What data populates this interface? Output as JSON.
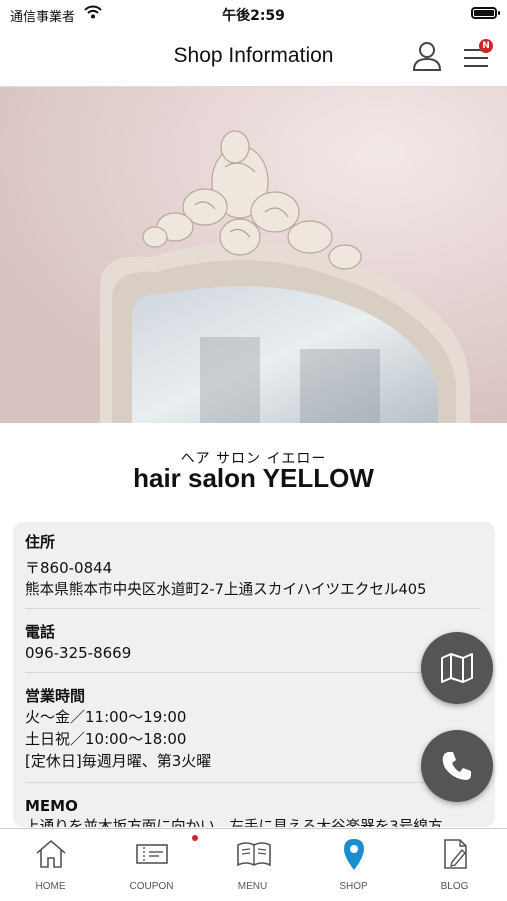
{
  "status_bar": {
    "carrier": "通信事業者",
    "time": "午後2:59"
  },
  "header": {
    "title": "Shop Information",
    "menu_badge": "N"
  },
  "shop": {
    "name_kana": "ヘア サロン イエロー",
    "name": "hair salon YELLOW"
  },
  "info": {
    "address_label": "住所",
    "postal_code": "〒860-0844",
    "address": "熊本県熊本市中央区水道町2-7上通スカイハイツエクセル405",
    "phone_label": "電話",
    "phone": "096-325-8669",
    "hours_label": "営業時間",
    "hours_weekday": "火〜金／11:00〜19:00",
    "hours_weekend": "土日祝／10:00〜18:00",
    "closed_days": "[定休日]毎週月曜、第3火曜",
    "memo_label": "MEMO",
    "memo": "上通りを並木坂方面に向かい、左手に見える大谷楽器を3号線方"
  },
  "tabs": [
    {
      "label": "HOME",
      "icon": "home-icon"
    },
    {
      "label": "COUPON",
      "icon": "coupon-icon"
    },
    {
      "label": "MENU",
      "icon": "menu-book-icon"
    },
    {
      "label": "SHOP",
      "icon": "location-pin-icon"
    },
    {
      "label": "BLOG",
      "icon": "blog-icon"
    }
  ],
  "colors": {
    "accent": "#1a8fd0",
    "fab": "#555555",
    "badge": "#d0232a"
  }
}
